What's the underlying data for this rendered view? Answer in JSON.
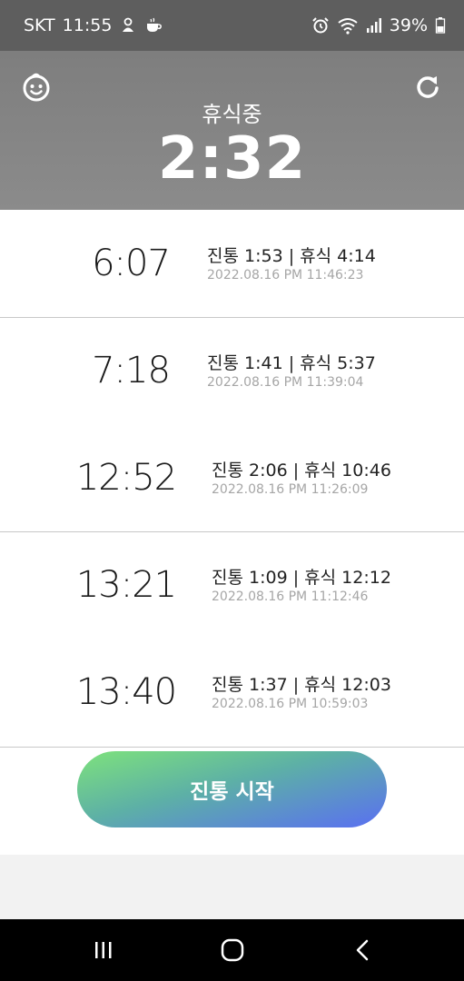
{
  "status_bar": {
    "carrier": "SKT",
    "time": "11:55",
    "battery": "39%",
    "left_icons": [
      "baby-notification-icon",
      "cup-notification-icon"
    ],
    "right_icons": [
      "alarm-icon",
      "wifi-icon",
      "signal-icon",
      "battery-icon"
    ]
  },
  "header": {
    "left_icon": "baby-face-icon",
    "right_icon": "refresh-icon",
    "mode": "휴식중",
    "timer": "2:32",
    "background": "#808080"
  },
  "records": [
    {
      "interval": "6:07",
      "detail": "진통 1:53 | 휴식 4:14",
      "timestamp": "2022.08.16 PM 11:46:23"
    },
    {
      "interval": "7:18",
      "detail": "진통 1:41 | 휴식 5:37",
      "timestamp": "2022.08.16 PM 11:39:04"
    },
    {
      "interval": "12:52",
      "detail": "진통 2:06 | 휴식 10:46",
      "timestamp": "2022.08.16 PM 11:26:09"
    },
    {
      "interval": "13:21",
      "detail": "진통 1:09 | 휴식 12:12",
      "timestamp": "2022.08.16 PM 11:12:46"
    },
    {
      "interval": "13:40",
      "detail": "진통 1:37 | 휴식 12:03",
      "timestamp": "2022.08.16 PM 10:59:03"
    }
  ],
  "action": {
    "start_label": "진통 시작",
    "gradient_colors": [
      "#7ee27c",
      "#5a6ff2"
    ]
  },
  "nav_bar": {
    "icons": [
      "recents-icon",
      "home-icon",
      "back-icon"
    ]
  }
}
